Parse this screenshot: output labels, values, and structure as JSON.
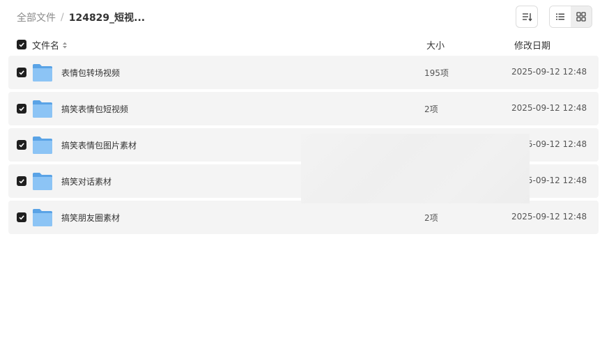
{
  "breadcrumb": {
    "root": "全部文件",
    "separator": "/",
    "current": "124829_短视..."
  },
  "toolbar": {
    "sort_icon": "sort-icon",
    "list_view_icon": "list-view-icon",
    "grid_view_icon": "grid-view-icon"
  },
  "table": {
    "headers": {
      "name": "文件名",
      "size": "大小",
      "date": "修改日期"
    },
    "rows": [
      {
        "name": "表情包转场视频",
        "size": "195项",
        "date": "2025-09-12 12:48"
      },
      {
        "name": "搞笑表情包短视频",
        "size": "2项",
        "date": "2025-09-12 12:48"
      },
      {
        "name": "搞笑表情包图片素材",
        "size": "",
        "date": "2025-09-12 12:48"
      },
      {
        "name": "搞笑对话素材",
        "size": "",
        "date": "2025-09-12 12:48"
      },
      {
        "name": "搞笑朋友圈素材",
        "size": "2项",
        "date": "2025-09-12 12:48"
      }
    ]
  },
  "colors": {
    "folder": "#7fb8f0",
    "checkbox": "#1f1f1f",
    "row_bg": "#f4f4f4"
  }
}
